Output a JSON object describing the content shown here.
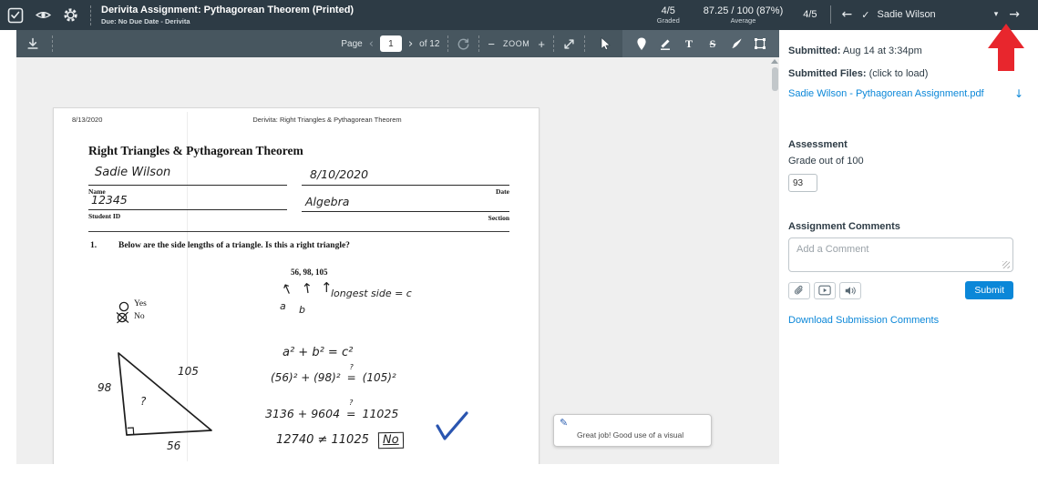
{
  "colors": {
    "header_bg": "#2d3b45",
    "toolbar_bg": "#47565f",
    "tools_panel_bg": "#55646e",
    "viewer_bg": "#efefef",
    "link_blue": "#0b87d8",
    "submit_blue": "#0b87d8",
    "arrow_red": "#e8262d",
    "ink_blue": "#2a55b0",
    "text_dark": "#2d3b45"
  },
  "header": {
    "title": "Derivita Assignment: Pythagorean Theorem (Printed)",
    "subtitle": "Due: No Due Date - Derivita",
    "graded_value": "4/5",
    "graded_label": "Graded",
    "average_value": "87.25 / 100 (87%)",
    "average_label": "Average",
    "position_value": "4/5",
    "prev_arrow": "←",
    "student_check": "✓",
    "student_name": "Sadie Wilson",
    "dropdown_caret": "▾",
    "next_arrow": "→"
  },
  "toolbar": {
    "page_label": "Page",
    "page_prev": "‹",
    "page_value": "1",
    "page_next": "›",
    "page_total": "of 12",
    "zoom_out": "−",
    "zoom_label": "ZOOM",
    "zoom_in": "+",
    "text_tool": "T",
    "strike_tool": "S"
  },
  "document": {
    "print_date": "8/13/2020",
    "print_header": "Derivita: Right Triangles & Pythagorean Theorem",
    "title": "Right Triangles & Pythagorean Theorem",
    "name_value": "Sadie Wilson",
    "name_label": "Name",
    "date_value": "8/10/2020",
    "date_label": "Date",
    "id_value": "12345",
    "id_label": "Student ID",
    "section_value": "Algebra",
    "section_label": "Section",
    "q1_number": "1.",
    "q1_text": "Below are the side lengths of a triangle. Is this a right triangle?",
    "q1_sides": "56, 98, 105",
    "arrows": {
      "glyph": "↑",
      "a": "a",
      "b": "b",
      "note": "longest side = c"
    },
    "yes_label": "Yes",
    "no_label": "No",
    "triangle": {
      "left_side": "98",
      "hypotenuse": "105",
      "base": "56",
      "angle": "?"
    },
    "work": {
      "line1": "a² + b² = c²",
      "line2_lhs": "(56)² + (98)²",
      "line2_rhs": "(105)²",
      "line3_lhs": "3136 + 9604",
      "line3_rhs": "11025",
      "line4": "12740 ≠ 11025",
      "qmark": "?",
      "eq": "=",
      "answer": "No"
    }
  },
  "comment_popup": {
    "text": "Great job! Good use of a visual"
  },
  "sidebar": {
    "submitted_label": "Submitted:",
    "submitted_value": " Aug 14 at 3:34pm",
    "files_label": "Submitted Files:",
    "files_hint": " (click to load)",
    "file_name": "Sadie Wilson - Pythagorean Assignment.pdf",
    "file_download_icon": "↓",
    "assessment_title": "Assessment",
    "grade_label": "Grade out of 100",
    "grade_value": "93",
    "comments_title": "Assignment Comments",
    "comment_placeholder": "Add a Comment",
    "submit_label": "Submit",
    "download_link": "Download Submission Comments"
  }
}
